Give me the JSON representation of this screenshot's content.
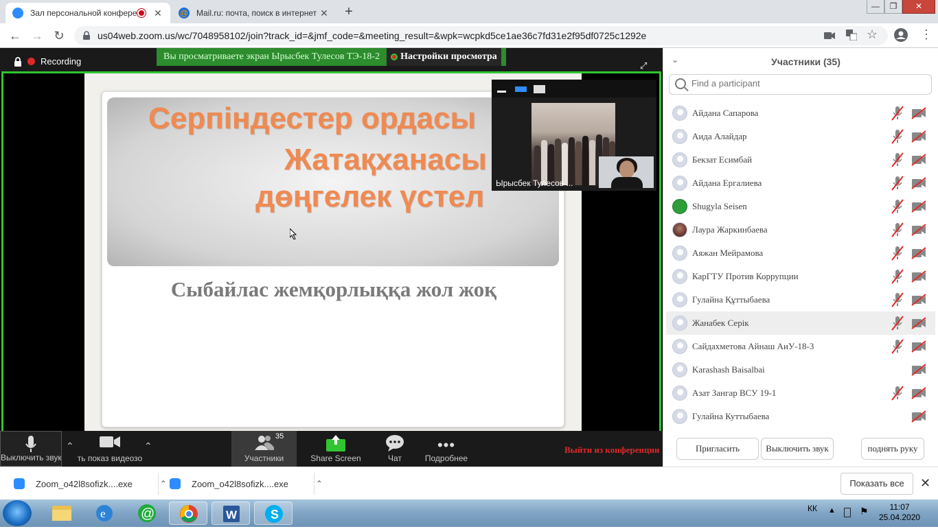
{
  "browser": {
    "tabs": [
      {
        "title": "Зал персональной конфере",
        "active": true
      },
      {
        "title": "Mail.ru: почта, поиск в интернет",
        "active": false
      }
    ],
    "url": "us04web.zoom.us/wc/7048958102/join?track_id=&jmf_code=&meeting_result=&wpk=wcpkd5ce1ae36c7fd31e2f95df0725c1292e"
  },
  "zoom": {
    "recording_label": "Recording",
    "viewing_banner": "Вы просматриваете экран Ырысбек Тулесов ТЭ-18-2",
    "view_settings": "Настройки просмотра",
    "slide": {
      "line1": "Серпіндестер ордасы",
      "line2": "Жатақханасы",
      "line3": "дөңгелек үстел",
      "subtitle": "Сыбайлас жемқорлыққа жол жоқ"
    },
    "video_name": "Ырысбек Тулесов ...",
    "controls": {
      "mute": "Выключить звук",
      "video": "ть показ видеозо",
      "participants": "Участники",
      "participants_count": "35",
      "share": "Share Screen",
      "chat": "Чат",
      "more": "Подробнее",
      "leave": "Выйти из конференции"
    }
  },
  "panel": {
    "title": "Участники (35)",
    "search_placeholder": "Find a participant",
    "participants": [
      {
        "name": "Айдана Сапарова",
        "avatar": "generic",
        "mic_muted": true
      },
      {
        "name": "Аида Алайдар",
        "avatar": "generic",
        "mic_muted": true
      },
      {
        "name": "Бекзат Есимбай",
        "avatar": "generic",
        "mic_muted": true
      },
      {
        "name": "Айдана Ергалиева",
        "avatar": "generic",
        "mic_muted": true
      },
      {
        "name": "Shugyla Seisen",
        "avatar": "green",
        "mic_muted": true
      },
      {
        "name": "Лаура Жаркинбаева",
        "avatar": "photo",
        "mic_muted": true
      },
      {
        "name": "Аяжан Мейрамова",
        "avatar": "generic",
        "mic_muted": true
      },
      {
        "name": "КарГТУ Против Коррупции",
        "avatar": "generic",
        "mic_muted": true
      },
      {
        "name": "Гулайна Құттыбаева",
        "avatar": "generic",
        "mic_muted": true
      },
      {
        "name": "Жанабек Серік",
        "avatar": "generic",
        "mic_muted": true,
        "highlighted": true
      },
      {
        "name": "Сайдахметова Айнаш АиУ-18-3",
        "avatar": "generic",
        "mic_muted": true
      },
      {
        "name": "Karashash Baisalbai",
        "avatar": "generic",
        "mic_muted": false
      },
      {
        "name": "Азат Зангар ВСУ 19-1",
        "avatar": "generic",
        "mic_muted": true
      },
      {
        "name": "Гулайна Куттыбаева",
        "avatar": "generic",
        "mic_muted": false
      }
    ],
    "buttons": {
      "invite": "Пригласить",
      "mute_all": "Выключить звук",
      "raise_hand": "поднять руку"
    }
  },
  "downloads": {
    "items": [
      "Zoom_o42l8sofizk....exe",
      "Zoom_o42l8sofizk....exe"
    ],
    "show_all": "Показать все"
  },
  "taskbar": {
    "lang": "КК",
    "time": "11:07",
    "date": "25.04.2020"
  },
  "colors": {
    "share_border": "#31c531",
    "banner_green": "#2d8c2d",
    "slide_title": "#ef8a52",
    "leave_red": "#e02828",
    "zoom_blue": "#2d8cff"
  }
}
